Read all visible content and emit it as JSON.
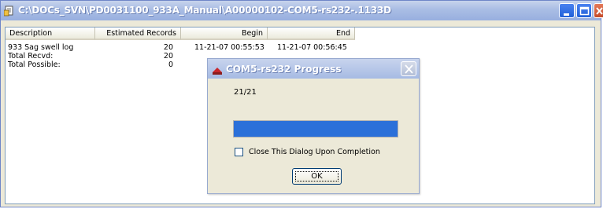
{
  "window": {
    "title": "C:\\DOCs_SVN\\PD0031100_933A_Manual\\A00000102-COM5-rs232-.1133D",
    "icon": "document-icon",
    "buttons": [
      "minimize-icon",
      "maximize-icon",
      "close-icon"
    ]
  },
  "list": {
    "columns": [
      "Description",
      "Estimated Records",
      "Begin",
      "End"
    ],
    "rows": [
      {
        "description": "933 Sag swell log",
        "records": "20",
        "begin": "11-21-07 00:55:53",
        "end": "11-21-07 00:56:45"
      },
      {
        "description": "Total Recvd:",
        "records": "20",
        "begin": "",
        "end": ""
      },
      {
        "description": "Total Possible:",
        "records": "0",
        "begin": "",
        "end": ""
      }
    ]
  },
  "dialog": {
    "title": "COM5-rs232 Progress",
    "count": "21/21",
    "progress": 1.0,
    "checkbox_label": "Close This Dialog Upon Completion",
    "checkbox_checked": false,
    "ok_label": "OK"
  },
  "colors": {
    "titlebar": "#a9bde4",
    "progress_fill": "#2b70d9",
    "window_bg": "#ece9d8"
  }
}
